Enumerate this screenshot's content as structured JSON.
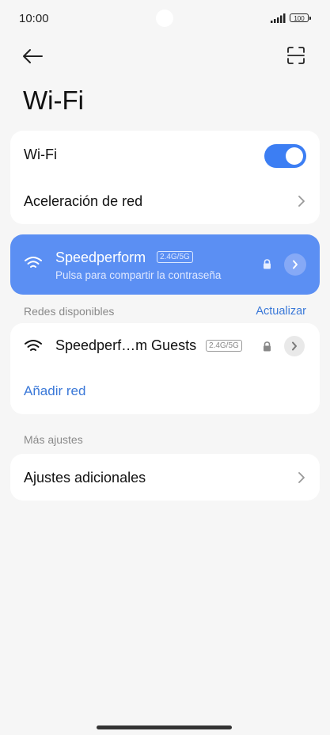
{
  "status": {
    "time": "10:00",
    "battery": "100"
  },
  "header": {
    "title": "Wi-Fi"
  },
  "wifi_card": {
    "toggle_label": "Wi-Fi",
    "toggle_on": true,
    "acceleration_label": "Aceleración de red"
  },
  "connected": {
    "ssid": "Speedperform",
    "band": "2.4G/5G",
    "subtitle": "Pulsa para compartir la contraseña"
  },
  "available": {
    "section_label": "Redes disponibles",
    "refresh_label": "Actualizar",
    "networks": [
      {
        "ssid": "Speedperf…m Guests",
        "band": "2.4G/5G"
      }
    ],
    "add_label": "Añadir red"
  },
  "more": {
    "section_label": "Más ajustes",
    "additional_label": "Ajustes adicionales"
  },
  "colors": {
    "accent": "#3c7ef3",
    "connected_bg": "#5b8ff3",
    "link": "#3a78d8",
    "background": "#f6f6f6"
  }
}
